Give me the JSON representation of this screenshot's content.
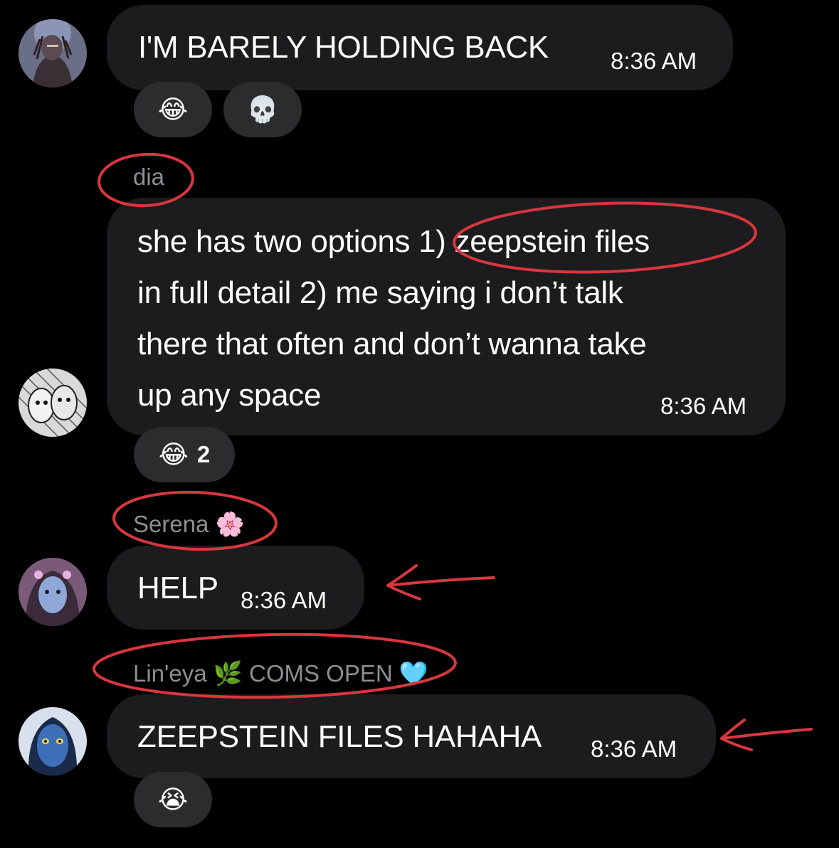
{
  "messages": [
    {
      "sender": "",
      "avatar": "avatar-warrior",
      "text": "I'M BARELY HOLDING BACK",
      "time": "8:36 AM",
      "reactions": [
        {
          "emoji": "😂",
          "icon": "laughing-tears-emoji",
          "count": ""
        },
        {
          "emoji": "💀",
          "icon": "skull-emoji",
          "count": ""
        }
      ]
    },
    {
      "sender": "dia",
      "avatar": "avatar-sketch",
      "lines": [
        "she has two options 1) zeepstein files",
        "in full detail 2) me saying i don’t talk",
        "there that often and don’t wanna take",
        "up any space"
      ],
      "time": "8:36 AM",
      "reactions": [
        {
          "emoji": "😂",
          "icon": "laughing-tears-emoji",
          "count": "2"
        }
      ]
    },
    {
      "sender": "Serena",
      "sender_emoji": "🌸",
      "avatar": "avatar-serena",
      "text": "HELP",
      "time": "8:36 AM"
    },
    {
      "sender": "Lin'eya",
      "sender_emoji": "🌿",
      "sender_suffix": "COMS OPEN",
      "sender_emoji2": "🩵",
      "avatar": "avatar-navi",
      "text": "ZEEPSTEIN FILES HAHAHA",
      "time": "8:36 AM",
      "reactions": [
        {
          "emoji": "😭",
          "icon": "loudly-crying-emoji",
          "count": ""
        }
      ]
    }
  ],
  "colors": {
    "background": "#000000",
    "bubble": "#1c1c1e",
    "reaction": "#2c2c2e",
    "sender": "#8e8e93",
    "annotation": "#d9363e"
  }
}
